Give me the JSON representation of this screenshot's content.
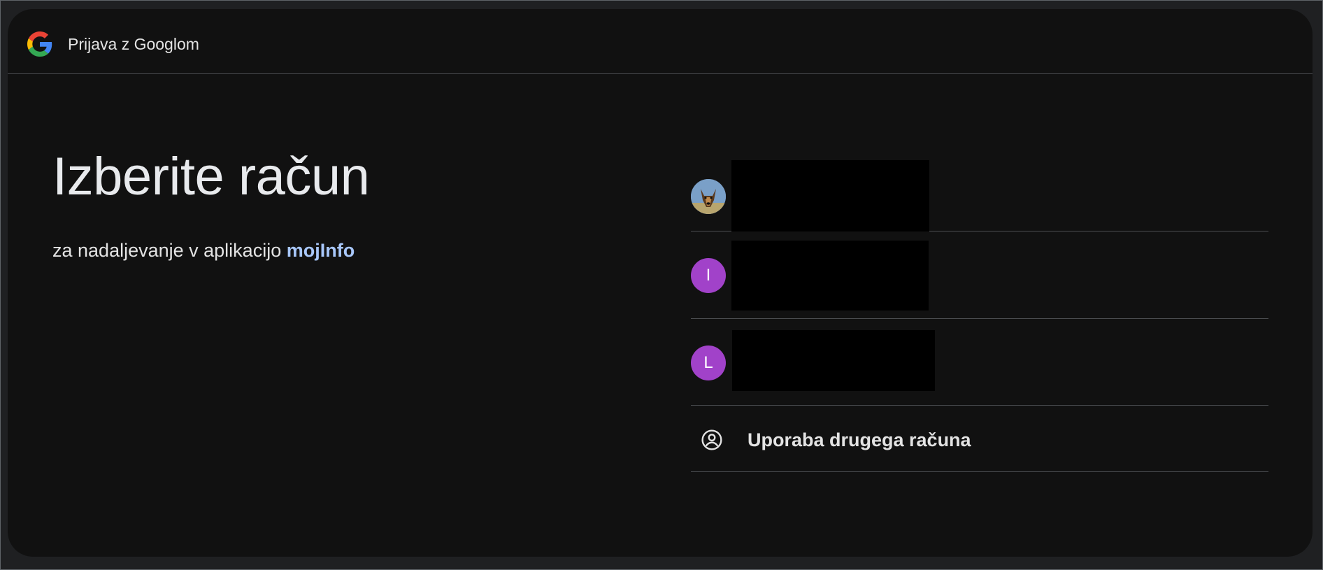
{
  "header": {
    "title": "Prijava z Googlom",
    "logo_icon": "google-g-icon"
  },
  "main": {
    "heading": "Izberite račun",
    "subtitle_prefix": "za nadaljevanje v aplikacijo",
    "app_name": "mojInfo"
  },
  "accounts": [
    {
      "avatar_type": "photo",
      "avatar_letter": "",
      "avatar_color": "#6b8fb5"
    },
    {
      "avatar_type": "letter",
      "avatar_letter": "I",
      "avatar_color": "#a142c9"
    },
    {
      "avatar_type": "letter",
      "avatar_letter": "L",
      "avatar_color": "#a142c9"
    }
  ],
  "use_another": {
    "label": "Uporaba drugega računa",
    "icon": "account-circle-icon"
  },
  "colors": {
    "background": "#111111",
    "text": "#e3e3e3",
    "link": "#a8c7fa",
    "avatar_purple": "#a142c9",
    "divider": "#4a4c50"
  }
}
